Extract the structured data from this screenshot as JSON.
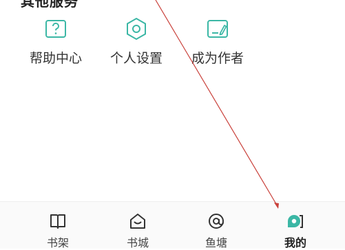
{
  "section": {
    "clipped_heading": "其他服务"
  },
  "tools": [
    {
      "label": "帮助中心",
      "icon": "help-icon"
    },
    {
      "label": "个人设置",
      "icon": "settings-icon"
    },
    {
      "label": "成为作者",
      "icon": "author-icon"
    }
  ],
  "tabbar": {
    "items": [
      {
        "label": "书架",
        "icon": "bookshelf-icon",
        "active": false
      },
      {
        "label": "书城",
        "icon": "bookstore-icon",
        "active": false
      },
      {
        "label": "鱼塘",
        "icon": "fishpond-icon",
        "active": false
      },
      {
        "label": "我的",
        "icon": "profile-icon",
        "active": true
      }
    ]
  },
  "colors": {
    "accent": "#3bb7a5",
    "annotation": "#c9403a"
  }
}
